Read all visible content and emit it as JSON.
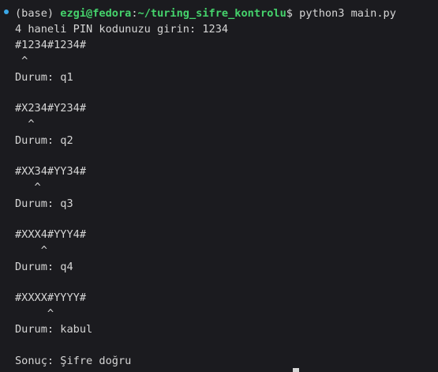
{
  "prompt": {
    "env": "(base)",
    "user_host": "ezgi@fedora",
    "separator": ":",
    "path": "~/turing_sifre_kontrolu",
    "symbol": "$",
    "command": "python3 main.py"
  },
  "output": [
    "4 haneli PIN kodunuzu girin: 1234",
    "#1234#1234#",
    " ^",
    "Durum: q1",
    "#X234#Y234#",
    "  ^",
    "Durum: q2",
    "#XX34#YY34#",
    "   ^",
    "Durum: q3",
    "#XXX4#YYY4#",
    "    ^",
    "Durum: q4",
    "#XXXX#YYYY#",
    "     ^",
    "Durum: kabul",
    "Sonuç: Şifre doğru"
  ],
  "colors": {
    "background": "#1b1b1f",
    "text": "#d6d6d6",
    "prompt_green": "#45d36c",
    "status_dot": "#3aa8e8"
  }
}
